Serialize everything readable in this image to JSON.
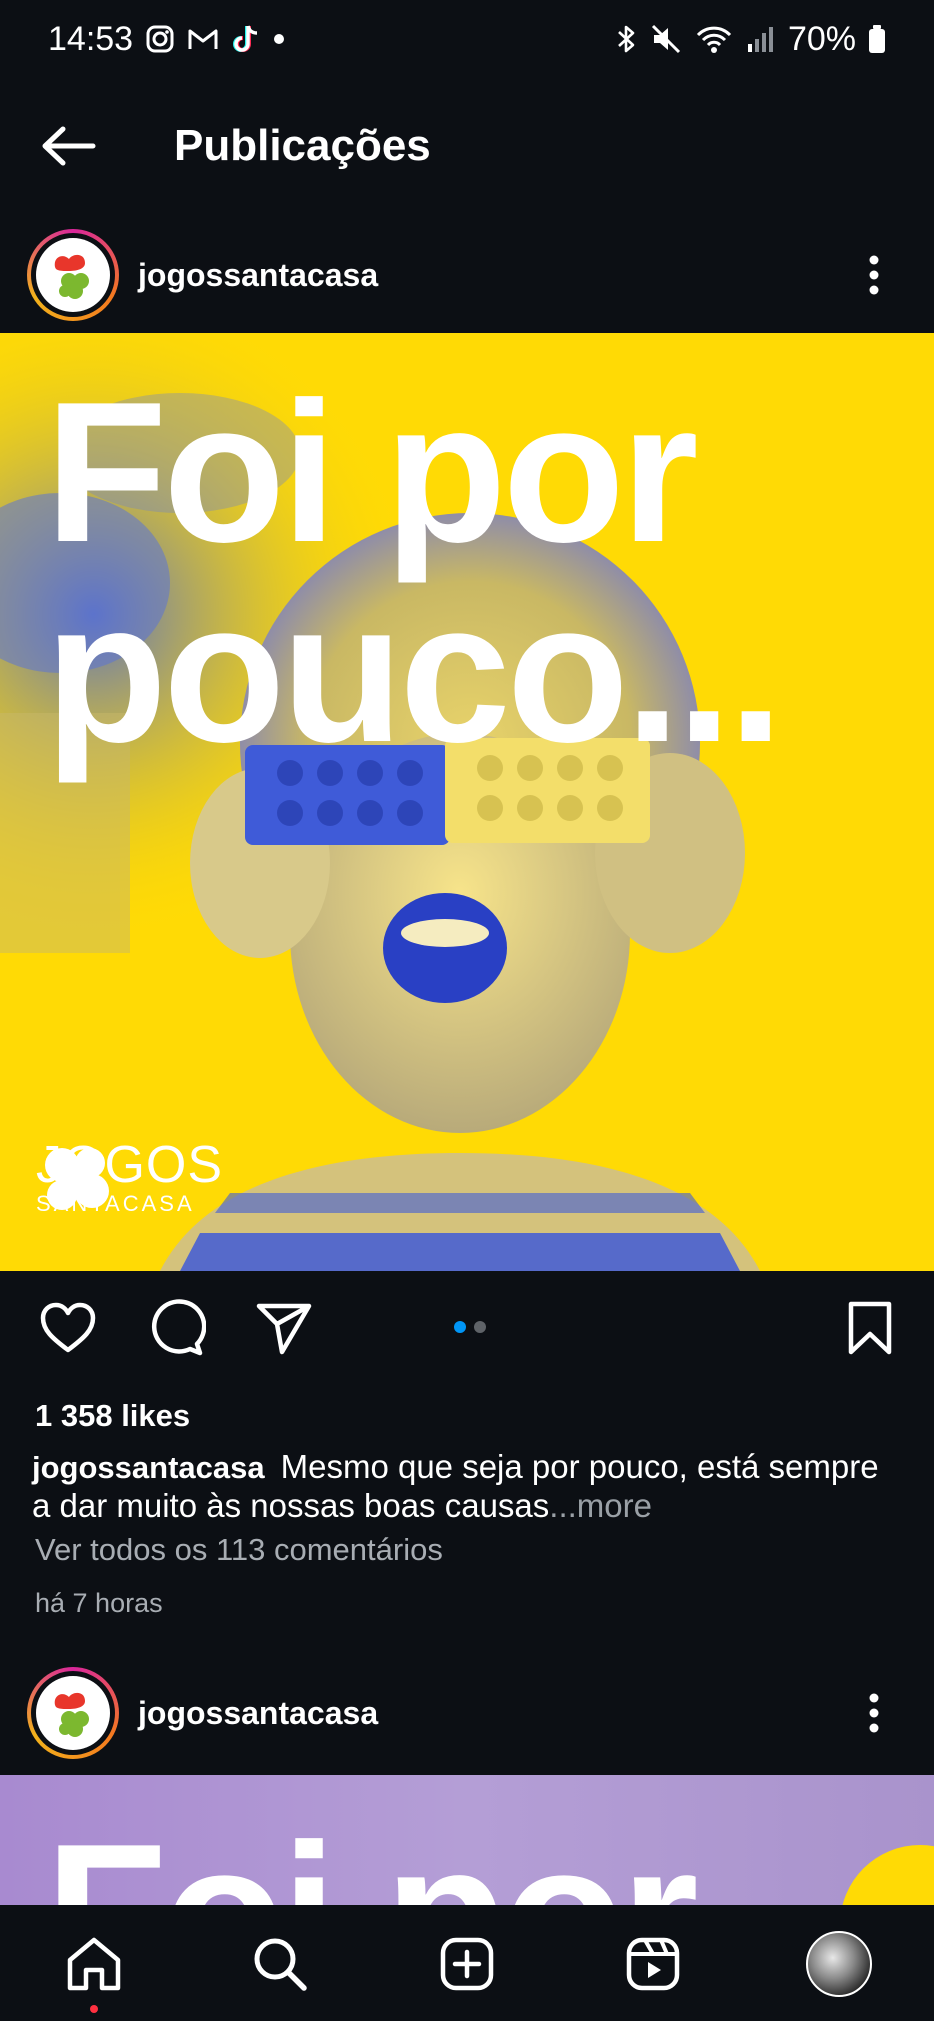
{
  "status_bar": {
    "time": "14:53",
    "battery": "70%",
    "icons": [
      "instagram-icon",
      "gmail-icon",
      "tiktok-icon",
      "dot-icon",
      "bluetooth-icon",
      "mute-icon",
      "wifi-icon",
      "signal-icon",
      "battery-icon"
    ]
  },
  "header": {
    "title": "Publicações"
  },
  "post1": {
    "username": "jogossantacasa",
    "image_headline_line1": "Foi por",
    "image_headline_line2": "pouco...",
    "brand_line1": "JOGOS",
    "brand_line2": "SANTACASA",
    "carousel": {
      "current": 1,
      "total": 2
    },
    "likes": "1 358 likes",
    "caption_user": "jogossantacasa",
    "caption_text": "Mesmo que seja por pouco, está sempre a dar muito às nossas boas causas",
    "more_label": "...more",
    "view_comments": "Ver todos os 113 comentários",
    "time_ago": "há 7 horas"
  },
  "post2": {
    "username": "jogossantacasa",
    "image_headline": "Foi por"
  },
  "bottom_nav": {
    "items": [
      "home-icon",
      "search-icon",
      "create-icon",
      "reels-icon",
      "profile-avatar"
    ]
  },
  "colors": {
    "background": "#0c0f14",
    "image_yellow": "#ffda05",
    "image_blue": "#3f5bd8",
    "dot_active": "#0095f6",
    "dot_inactive": "#5f6368",
    "notification": "#ff3040",
    "secondary_text": "#a8adb3"
  }
}
